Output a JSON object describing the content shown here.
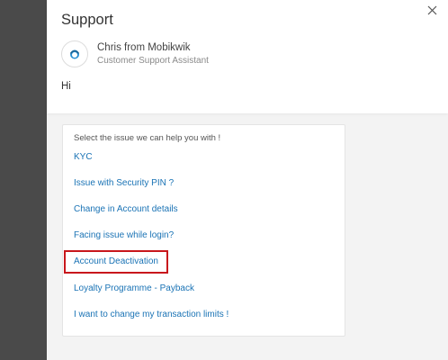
{
  "support": {
    "title": "Support",
    "close_icon": "close-icon",
    "agent": {
      "name": "Chris from Mobikwik",
      "role": "Customer Support Assistant",
      "avatar_icon": "agent-avatar-icon"
    },
    "greeting": "Hi"
  },
  "issues": {
    "prompt": "Select the issue we can help you with !",
    "options": [
      "KYC",
      "Issue with Security PIN ?",
      "Change in Account details",
      "Facing issue while login?",
      "Account Deactivation",
      "Loyalty Programme - Payback",
      "I want to change my transaction limits !"
    ],
    "highlighted_option": "Account Deactivation"
  },
  "colors": {
    "link": "#1a73b5",
    "highlight": "#c8171c",
    "overlay": "#4a4a4a"
  }
}
